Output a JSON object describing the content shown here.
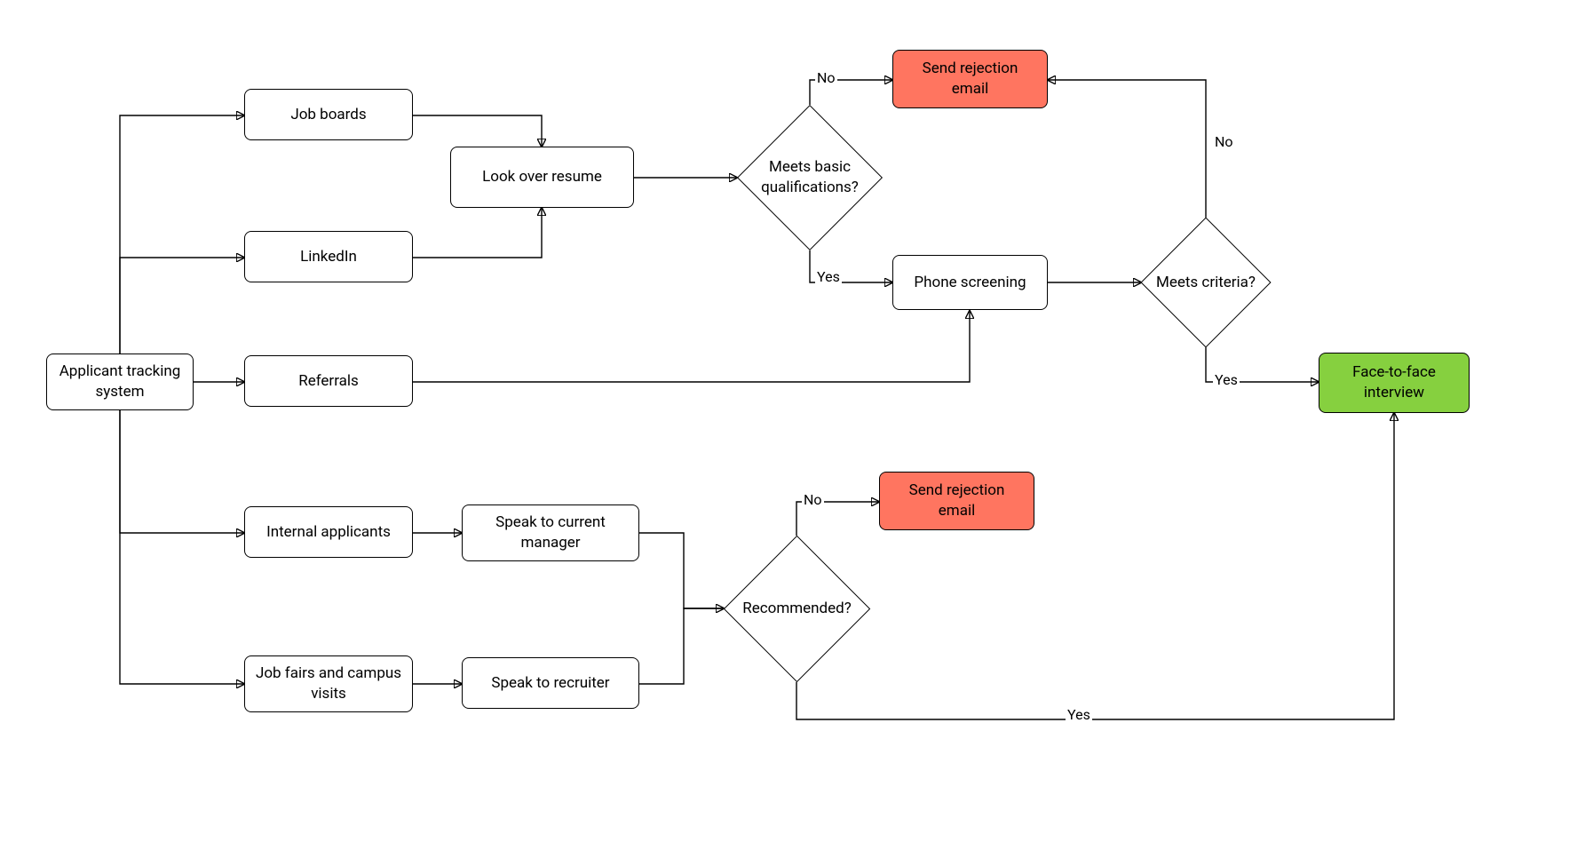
{
  "nodes": {
    "ats": {
      "label": "Applicant tracking system"
    },
    "job_boards": {
      "label": "Job boards"
    },
    "linkedin": {
      "label": "LinkedIn"
    },
    "referrals": {
      "label": "Referrals"
    },
    "internal": {
      "label": "Internal applicants"
    },
    "jobfairs": {
      "label": "Job fairs and campus visits"
    },
    "look_resume": {
      "label": "Look over resume"
    },
    "speak_manager": {
      "label": "Speak to current manager"
    },
    "speak_recruiter": {
      "label": "Speak to recruiter"
    },
    "meets_basic": {
      "label": "Meets basic qualifications?"
    },
    "recommended": {
      "label": "Recommended?"
    },
    "meets_criteria": {
      "label": "Meets criteria?"
    },
    "phone_screen": {
      "label": "Phone screening"
    },
    "reject1": {
      "label": "Send rejection email"
    },
    "reject2": {
      "label": "Send rejection email"
    },
    "interview": {
      "label": "Face-to-face interview"
    }
  },
  "edge_labels": {
    "basic_no": "No",
    "basic_yes": "Yes",
    "criteria_no": "No",
    "criteria_yes": "Yes",
    "recommended_no": "No",
    "recommended_yes": "Yes"
  },
  "colors": {
    "reject": "#ff7560",
    "success": "#86d03f",
    "stroke": "#000000",
    "bg": "#ffffff"
  }
}
